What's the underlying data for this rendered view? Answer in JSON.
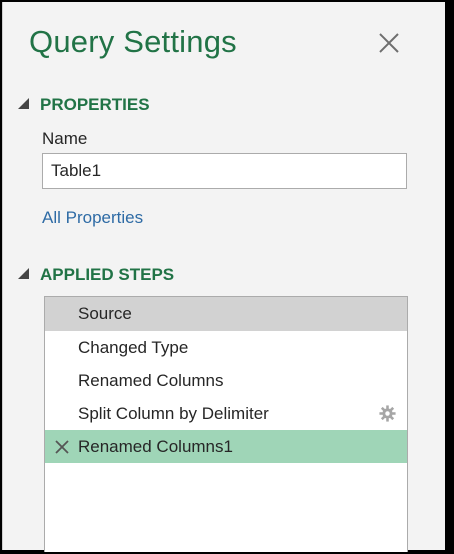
{
  "pane": {
    "title": "Query Settings",
    "close_icon": "close-icon"
  },
  "properties": {
    "heading": "PROPERTIES",
    "name_label": "Name",
    "name_value": "Table1",
    "all_properties_link": "All Properties"
  },
  "applied_steps": {
    "heading": "APPLIED STEPS",
    "items": [
      {
        "label": "Source",
        "state": "hover"
      },
      {
        "label": "Changed Type",
        "state": "normal"
      },
      {
        "label": "Renamed Columns",
        "state": "normal"
      },
      {
        "label": "Split Column by Delimiter",
        "state": "normal",
        "icon": "gear-icon"
      },
      {
        "label": "Renamed Columns1",
        "state": "selected",
        "icon": "delete-step-icon"
      }
    ]
  },
  "colors": {
    "accent": "#217346",
    "link": "#2e6ba5",
    "selected_row": "#9fd5b7",
    "hover_row": "#d2d2d2"
  }
}
